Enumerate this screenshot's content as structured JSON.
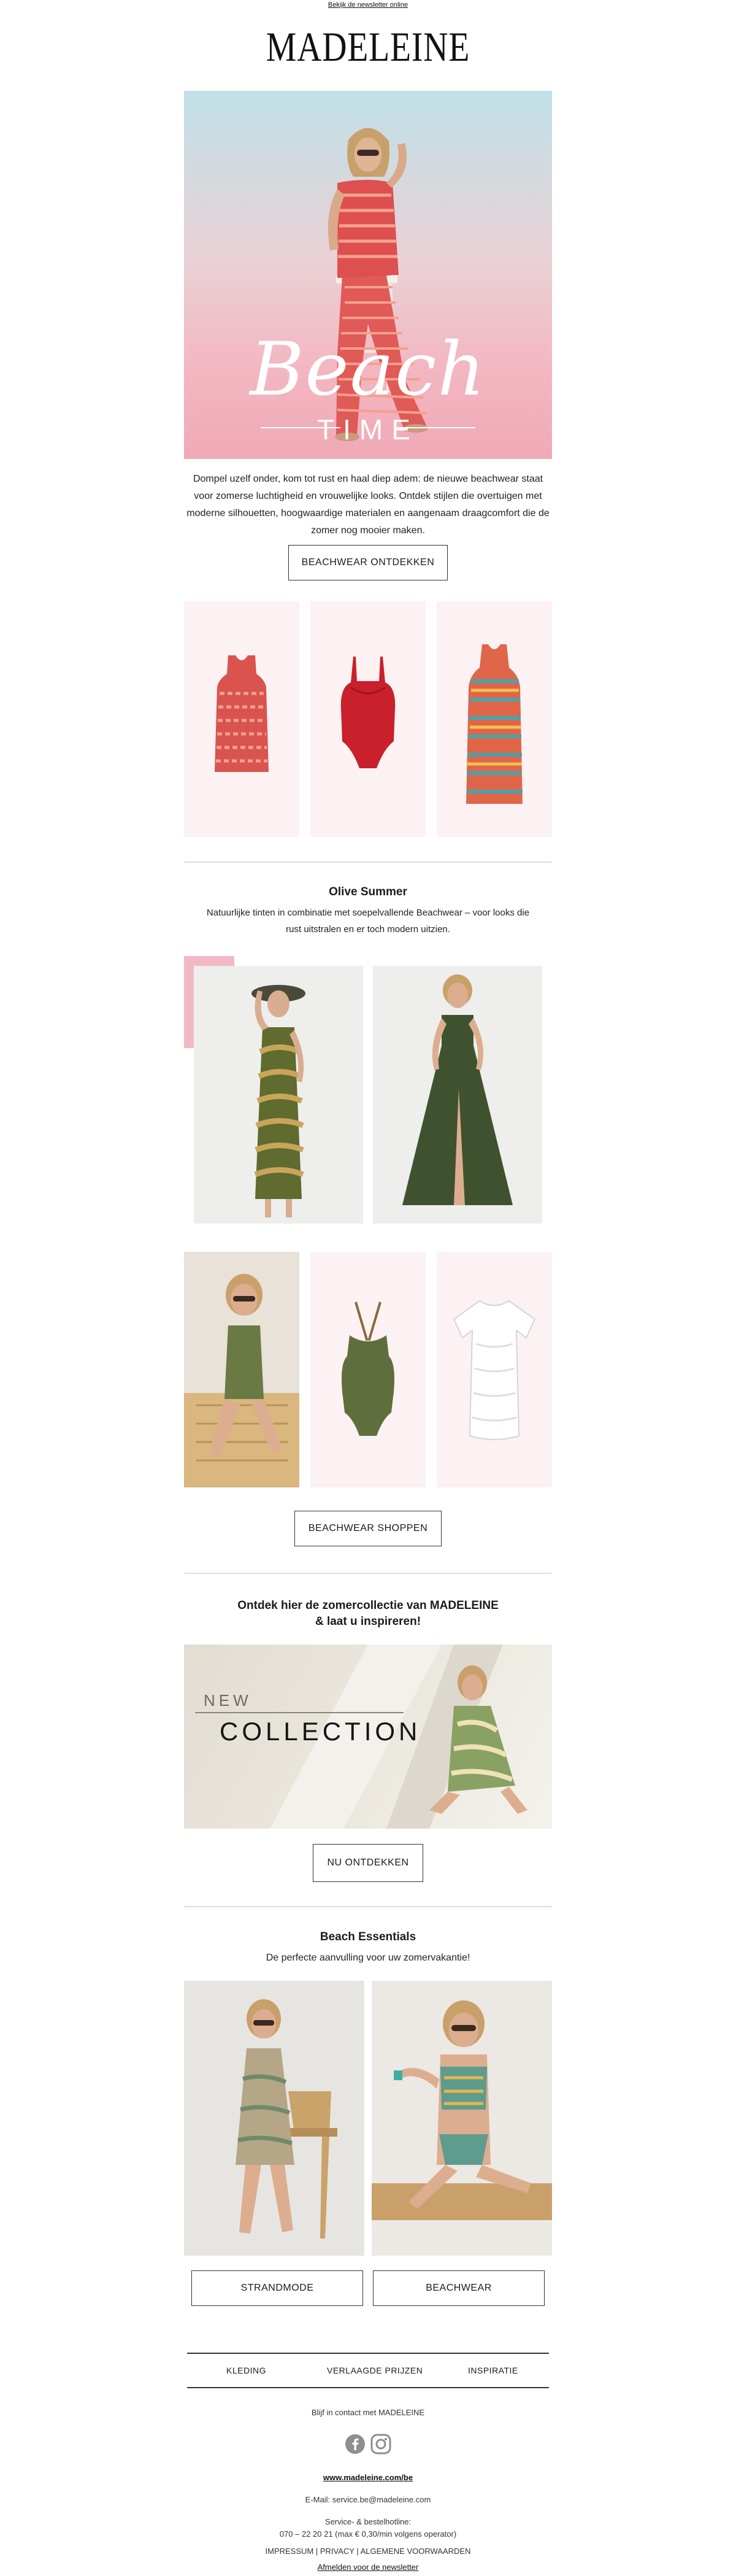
{
  "header": {
    "view_online": "Bekijk de newsletter online",
    "logo": "MADELEINE"
  },
  "hero": {
    "word_script": "Beach",
    "word_caps": "TIME",
    "intro": "Dompel uzelf onder, kom tot rust en haal diep adem: de nieuwe beachwear staat voor zomerse luchtigheid en vrouwelijke looks. Ontdek stijlen die overtuigen met moderne silhouetten, hoogwaardige materialen en aangenaam draagcomfort die de zomer nog mooier maken.",
    "cta": "BEACHWEAR ONTDEKKEN"
  },
  "olive": {
    "title": "Olive Summer",
    "subtitle": "Natuurlijke tinten in combinatie met soepelvallende Beachwear – voor looks die rust uitstralen en er toch modern uitzien.",
    "cta": "BEACHWEAR SHOPPEN"
  },
  "collection": {
    "title_line1": "Ontdek hier de zomercollectie van MADELEINE",
    "title_line2": "& laat u inspireren!",
    "banner_new": "NEW",
    "banner_collection": "COLLECTION",
    "cta": "NU ONTDEKKEN"
  },
  "essentials": {
    "title": "Beach Essentials",
    "subtitle": "De perfecte aanvulling voor uw zomervakantie!",
    "cta_left": "STRANDMODE",
    "cta_right": "BEACHWEAR"
  },
  "footer": {
    "nav": [
      "KLEDING",
      "VERLAAGDE PRIJZEN",
      "INSPIRATIE"
    ],
    "contact_heading": "Blijf in contact met MADELEINE",
    "social_icons": [
      "facebook-icon",
      "instagram-icon"
    ],
    "website": "www.madeleine.com/be",
    "email": "E-Mail: service.be@madeleine.com",
    "hotline_label": "Service- & bestelhotline:",
    "hotline": "070 – 22 20 21 (max € 0,30/min volgens operator)",
    "legal": "IMPRESSUM | PRIVACY | ALGEMENE VOORWAARDEN",
    "unsubscribe": "Afmelden voor de newsletter"
  },
  "colors": {
    "accent_pink": "#f2b9c4",
    "tile_pink": "#fcf1f3",
    "olive": "#5b6e3a",
    "text": "#1b1b1b"
  }
}
